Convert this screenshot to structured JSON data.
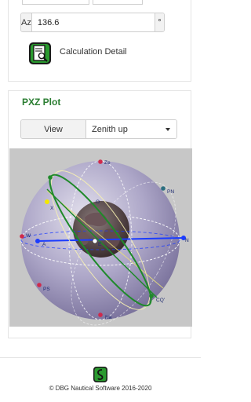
{
  "azimuth": {
    "label": "Az",
    "value": "136.6",
    "unit": "°"
  },
  "calculation": {
    "label": "Calculation Detail",
    "icon": "calculation-detail-icon"
  },
  "pxz": {
    "title": "PXZ Plot",
    "view_button": "View",
    "view_option": "Zenith up",
    "labels": {
      "zenith": "Ze",
      "pn": "PN",
      "o": "O",
      "x": "X",
      "w": "W",
      "a": "A",
      "e": "E",
      "n": "N",
      "ps": "PS",
      "cq": "CQ'",
      "na": "Na"
    },
    "colors": {
      "accent_green": "#1f8a2a",
      "horizon_blue": "#1b3cff",
      "point_red": "#d0294b"
    }
  },
  "footer": {
    "text": "© DBG Nautical Software 2016-2020"
  }
}
